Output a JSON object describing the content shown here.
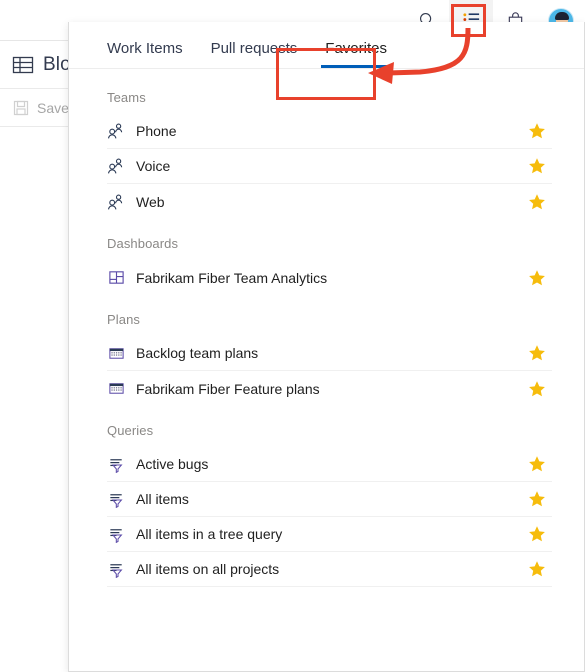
{
  "app": {
    "background": {
      "page_title": "Blog",
      "page_title_icon": "table-icon",
      "save_label": "Save",
      "save_icon": "floppy-disk-icon"
    },
    "topbar": {
      "icons": [
        {
          "name": "search-icon",
          "label": "Search"
        },
        {
          "name": "work-list-icon",
          "label": "Work"
        },
        {
          "name": "marketplace-bag-icon",
          "label": "Marketplace"
        },
        {
          "name": "user-avatar",
          "label": "User profile"
        }
      ]
    }
  },
  "flyout": {
    "tabs": [
      {
        "label": "Work Items",
        "selected": false
      },
      {
        "label": "Pull requests",
        "selected": false
      },
      {
        "label": "Favorites",
        "selected": true
      }
    ],
    "groups": [
      {
        "header": "Teams",
        "icon": "people-group-icon",
        "items": [
          {
            "label": "Phone",
            "favorited": true
          },
          {
            "label": "Voice",
            "favorited": true
          },
          {
            "label": "Web",
            "favorited": true
          }
        ]
      },
      {
        "header": "Dashboards",
        "icon": "dashboard-grid-icon",
        "items": [
          {
            "label": "Fabrikam Fiber Team Analytics",
            "favorited": true
          }
        ]
      },
      {
        "header": "Plans",
        "icon": "plan-calendar-icon",
        "items": [
          {
            "label": "Backlog team plans",
            "favorited": true
          },
          {
            "label": "Fabrikam Fiber Feature plans",
            "favorited": true
          }
        ]
      },
      {
        "header": "Queries",
        "icon": "query-filter-icon",
        "items": [
          {
            "label": "Active bugs",
            "favorited": true
          },
          {
            "label": "All items",
            "favorited": true
          },
          {
            "label": "All items in a tree query",
            "favorited": true
          },
          {
            "label": "All items on all projects",
            "favorited": true
          }
        ]
      }
    ]
  },
  "annotations": {
    "highlight_color": "#e8412c",
    "callouts": [
      {
        "name": "work-list-icon-highlight",
        "target": "work-list-icon"
      },
      {
        "name": "favorites-tab-highlight",
        "target": "favorites-tab"
      }
    ],
    "arrow": {
      "name": "callout-arrow",
      "from": "work-list-icon",
      "to": "favorites-tab"
    }
  },
  "colors": {
    "accent_blue": "#005eb8",
    "star_gold": "#f6bc0c",
    "icon_navy": "#333b4f",
    "highlight_red": "#e8412c"
  }
}
